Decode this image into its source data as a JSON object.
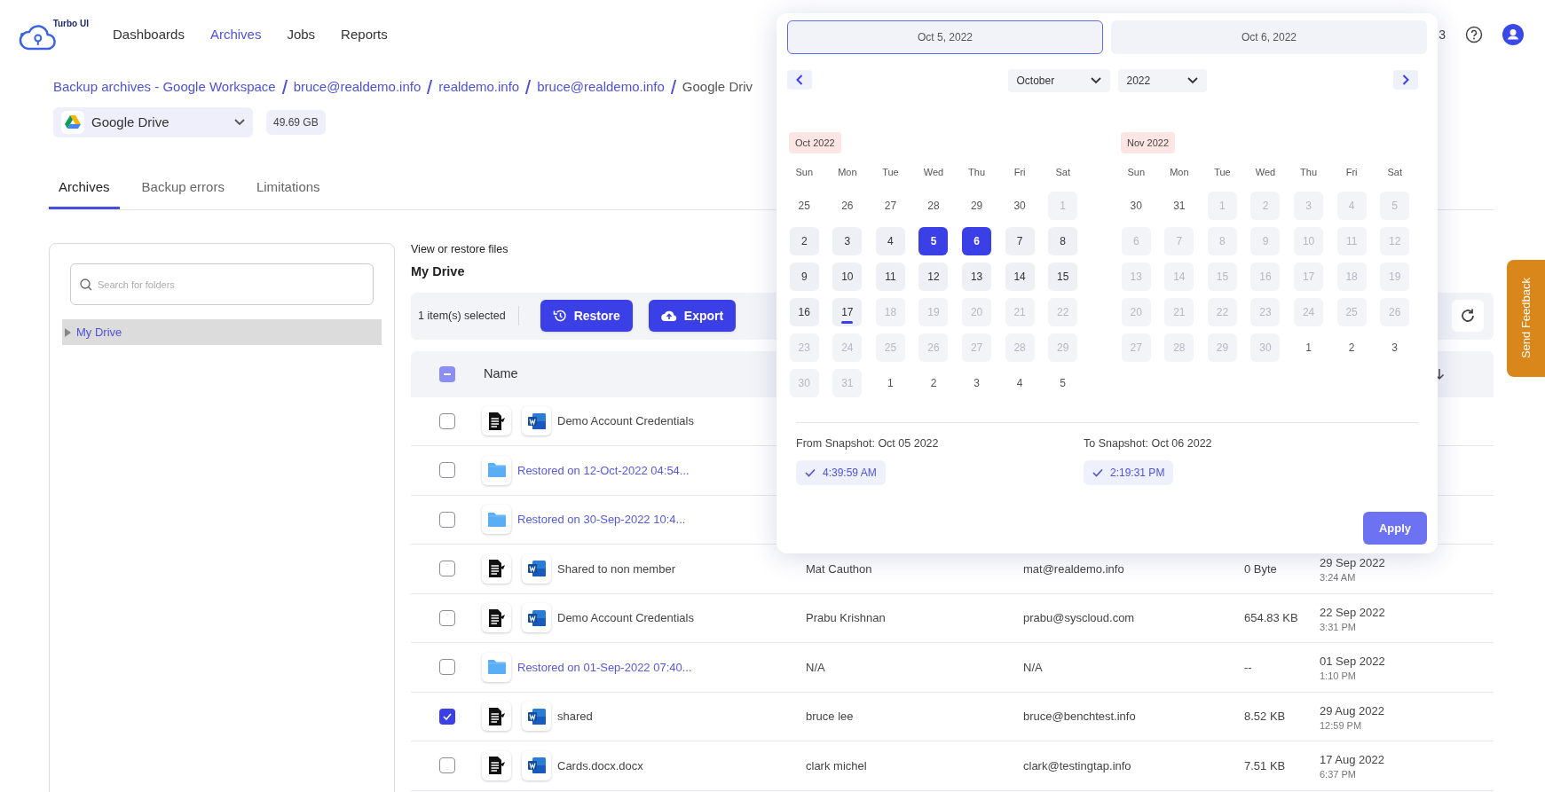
{
  "app": {
    "logo_text": "Turbo UI"
  },
  "nav": [
    {
      "label": "Dashboards",
      "selected": false
    },
    {
      "label": "Archives",
      "selected": true
    },
    {
      "label": "Jobs",
      "selected": false
    },
    {
      "label": "Reports",
      "selected": false
    }
  ],
  "header_right_text": "3",
  "breadcrumb": [
    {
      "label": "Backup archives - Google Workspace",
      "kind": "link"
    },
    {
      "label": "bruce@realdemo.info",
      "kind": "link"
    },
    {
      "label": "realdemo.info",
      "kind": "link"
    },
    {
      "label": "bruce@realdemo.info",
      "kind": "link"
    },
    {
      "label": "Google Driv",
      "kind": "current"
    }
  ],
  "source_select": {
    "value": "Google Drive"
  },
  "storage_badge": "49.69 GB",
  "tabs": [
    {
      "label": "Archives",
      "selected": true
    },
    {
      "label": "Backup errors",
      "selected": false
    },
    {
      "label": "Limitations",
      "selected": false
    }
  ],
  "folder_search": {
    "placeholder": "Search for folders"
  },
  "folder_tree": [
    {
      "label": "My Drive",
      "selected": true,
      "expanded": false
    }
  ],
  "files": {
    "subtitle": "View or restore files",
    "title": "My Drive",
    "selection_text": "1 item(s) selected",
    "actions": [
      {
        "label": "Restore",
        "kind": "restore"
      },
      {
        "label": "Export",
        "kind": "export"
      }
    ],
    "header_checkbox": {
      "indeterminate": true
    },
    "columns": [
      "Name"
    ],
    "rows": [
      {
        "kind": "file",
        "name": "Demo Account Credentials",
        "checked": false
      },
      {
        "kind": "folder",
        "name": "Restored on 12-Oct-2022 04:54...",
        "checked": false
      },
      {
        "kind": "folder",
        "name": "Restored on 30-Sep-2022 10:4...",
        "checked": false
      },
      {
        "kind": "file",
        "name": "Shared to non member",
        "checked": false,
        "owner": "Mat Cauthon",
        "email": "mat@realdemo.info",
        "size": "0 Byte",
        "date": "29 Sep 2022",
        "time": "3:24 AM"
      },
      {
        "kind": "file",
        "name": "Demo Account Credentials",
        "checked": false,
        "owner": "Prabu Krishnan",
        "email": "prabu@syscloud.com",
        "size": "654.83 KB",
        "date": "22 Sep 2022",
        "time": "3:31 PM"
      },
      {
        "kind": "folder",
        "name": "Restored on 01-Sep-2022 07:40...",
        "checked": false,
        "owner": "N/A",
        "email": "N/A",
        "size": "--",
        "date": "01 Sep 2022",
        "time": "1:10 PM"
      },
      {
        "kind": "file",
        "name": "shared",
        "checked": true,
        "owner": "bruce lee",
        "email": "bruce@benchtest.info",
        "size": "8.52 KB",
        "date": "29 Aug 2022",
        "time": "12:59 PM"
      },
      {
        "kind": "file",
        "name": "Cards.docx.docx",
        "checked": false,
        "owner": "clark michel",
        "email": "clark@testingtap.info",
        "size": "7.51 KB",
        "date": "17 Aug 2022",
        "time": "6:37 PM"
      }
    ]
  },
  "calendar": {
    "start_date": {
      "value": "Oct 5, 2022",
      "focused": true
    },
    "end_date": {
      "value": "Oct 6, 2022",
      "focused": false
    },
    "month_select": "October",
    "year_select": "2022",
    "months": [
      {
        "label": "Oct 2022",
        "weekdays": [
          "Sun",
          "Mon",
          "Tue",
          "Wed",
          "Thu",
          "Fri",
          "Sat"
        ],
        "days": [
          {
            "day": "25",
            "kind": "outside"
          },
          {
            "day": "26",
            "kind": "outside"
          },
          {
            "day": "27",
            "kind": "outside"
          },
          {
            "day": "28",
            "kind": "outside"
          },
          {
            "day": "29",
            "kind": "outside"
          },
          {
            "day": "30",
            "kind": "outside"
          },
          {
            "day": "1",
            "kind": "disabled"
          },
          {
            "day": "2",
            "kind": "enabled"
          },
          {
            "day": "3",
            "kind": "enabled"
          },
          {
            "day": "4",
            "kind": "enabled"
          },
          {
            "day": "5",
            "kind": "selected"
          },
          {
            "day": "6",
            "kind": "selected"
          },
          {
            "day": "7",
            "kind": "enabled"
          },
          {
            "day": "8",
            "kind": "enabled"
          },
          {
            "day": "9",
            "kind": "enabled"
          },
          {
            "day": "10",
            "kind": "enabled"
          },
          {
            "day": "11",
            "kind": "enabled"
          },
          {
            "day": "12",
            "kind": "enabled"
          },
          {
            "day": "13",
            "kind": "enabled"
          },
          {
            "day": "14",
            "kind": "enabled"
          },
          {
            "day": "15",
            "kind": "enabled"
          },
          {
            "day": "16",
            "kind": "enabled"
          },
          {
            "day": "17",
            "kind": "today"
          },
          {
            "day": "18",
            "kind": "disabled"
          },
          {
            "day": "19",
            "kind": "disabled"
          },
          {
            "day": "20",
            "kind": "disabled"
          },
          {
            "day": "21",
            "kind": "disabled"
          },
          {
            "day": "22",
            "kind": "disabled"
          },
          {
            "day": "23",
            "kind": "disabled"
          },
          {
            "day": "24",
            "kind": "disabled"
          },
          {
            "day": "25",
            "kind": "disabled"
          },
          {
            "day": "26",
            "kind": "disabled"
          },
          {
            "day": "27",
            "kind": "disabled"
          },
          {
            "day": "28",
            "kind": "disabled"
          },
          {
            "day": "29",
            "kind": "disabled"
          },
          {
            "day": "30",
            "kind": "disabled"
          },
          {
            "day": "31",
            "kind": "disabled"
          },
          {
            "day": "1",
            "kind": "outside"
          },
          {
            "day": "2",
            "kind": "outside"
          },
          {
            "day": "3",
            "kind": "outside"
          },
          {
            "day": "4",
            "kind": "outside"
          },
          {
            "day": "5",
            "kind": "outside"
          }
        ]
      },
      {
        "label": "Nov 2022",
        "weekdays": [
          "Sun",
          "Mon",
          "Tue",
          "Wed",
          "Thu",
          "Fri",
          "Sat"
        ],
        "days": [
          {
            "day": "30",
            "kind": "outside"
          },
          {
            "day": "31",
            "kind": "outside"
          },
          {
            "day": "1",
            "kind": "disabled"
          },
          {
            "day": "2",
            "kind": "disabled"
          },
          {
            "day": "3",
            "kind": "disabled"
          },
          {
            "day": "4",
            "kind": "disabled"
          },
          {
            "day": "5",
            "kind": "disabled"
          },
          {
            "day": "6",
            "kind": "disabled"
          },
          {
            "day": "7",
            "kind": "disabled"
          },
          {
            "day": "8",
            "kind": "disabled"
          },
          {
            "day": "9",
            "kind": "disabled"
          },
          {
            "day": "10",
            "kind": "disabled"
          },
          {
            "day": "11",
            "kind": "disabled"
          },
          {
            "day": "12",
            "kind": "disabled"
          },
          {
            "day": "13",
            "kind": "disabled"
          },
          {
            "day": "14",
            "kind": "disabled"
          },
          {
            "day": "15",
            "kind": "disabled"
          },
          {
            "day": "16",
            "kind": "disabled"
          },
          {
            "day": "17",
            "kind": "disabled"
          },
          {
            "day": "18",
            "kind": "disabled"
          },
          {
            "day": "19",
            "kind": "disabled"
          },
          {
            "day": "20",
            "kind": "disabled"
          },
          {
            "day": "21",
            "kind": "disabled"
          },
          {
            "day": "22",
            "kind": "disabled"
          },
          {
            "day": "23",
            "kind": "disabled"
          },
          {
            "day": "24",
            "kind": "disabled"
          },
          {
            "day": "25",
            "kind": "disabled"
          },
          {
            "day": "26",
            "kind": "disabled"
          },
          {
            "day": "27",
            "kind": "disabled"
          },
          {
            "day": "28",
            "kind": "disabled"
          },
          {
            "day": "29",
            "kind": "disabled"
          },
          {
            "day": "30",
            "kind": "disabled"
          },
          {
            "day": "1",
            "kind": "outside"
          },
          {
            "day": "2",
            "kind": "outside"
          },
          {
            "day": "3",
            "kind": "outside"
          }
        ]
      }
    ],
    "snapshots": [
      {
        "label": "From Snapshot: Oct 05 2022",
        "time": "4:39:59 AM"
      },
      {
        "label": "To Snapshot: Oct 06 2022",
        "time": "2:19:31 PM"
      }
    ],
    "apply": "Apply"
  },
  "feedback_tab": "Send Feedback"
}
